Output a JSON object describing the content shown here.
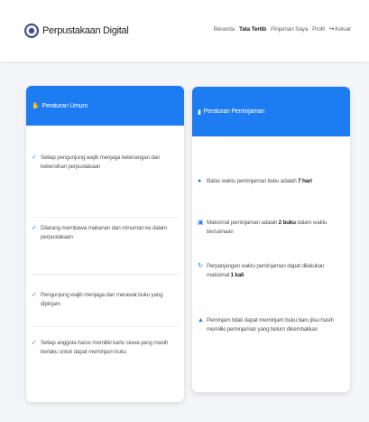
{
  "brand": {
    "name": "Perpustakaan Digital"
  },
  "nav": {
    "items": [
      "Beranda",
      "Tata Tertib",
      "Pinjaman Saya",
      "Profil"
    ],
    "logout": "Keluar"
  },
  "general_rules": {
    "title": "Peraturan Umum",
    "items": [
      "Setiap pengunjung wajib menjaga ketenangan dan kebersihan perpustakaan",
      "Dilarang membawa makanan dan minuman ke dalam perpustakaan",
      "Pengunjung wajib menjaga dan merawat buku yang dipinjam",
      "Setiap anggota harus memiliki kartu siswa yang masih berlaku untuk dapat meminjam buku"
    ]
  },
  "loan_rules": {
    "title": "Peraturan Peminjaman",
    "items": [
      {
        "pre": "Batas waktu peminjaman buku adalah ",
        "bold": "7 hari",
        "post": "",
        "icon": "clock-icon"
      },
      {
        "pre": "Maksimal peminjaman adalah ",
        "bold": "2 buku",
        "post": " dalam waktu bersamaan",
        "icon": "book-icon"
      },
      {
        "pre": "Perpanjangan waktu peminjaman dapat dilakukan maksimal ",
        "bold": "1 kali",
        "post": "",
        "icon": "renew-icon"
      },
      {
        "pre": "Peminjam tidak dapat meminjam buku baru jika masih memiliki peminjaman yang belum dikembalikan",
        "bold": "",
        "post": "",
        "icon": "warning-icon"
      }
    ]
  },
  "colors": {
    "accent": "#1d7cf2",
    "background": "#f4f5f8"
  }
}
